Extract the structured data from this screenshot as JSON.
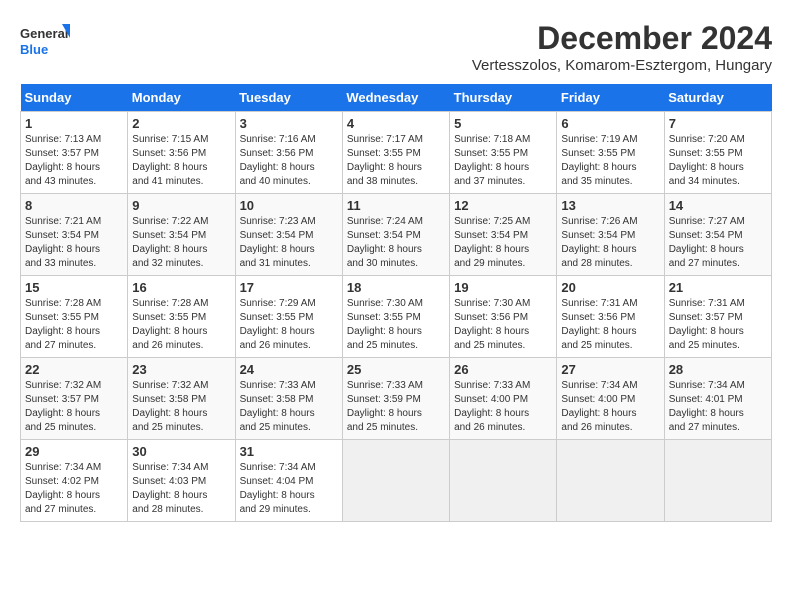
{
  "logo": {
    "line1": "General",
    "line2": "Blue"
  },
  "title": "December 2024",
  "location": "Vertesszolos, Komarom-Esztergom, Hungary",
  "weekdays": [
    "Sunday",
    "Monday",
    "Tuesday",
    "Wednesday",
    "Thursday",
    "Friday",
    "Saturday"
  ],
  "weeks": [
    [
      {
        "day": "1",
        "sunrise": "7:13 AM",
        "sunset": "3:57 PM",
        "daylight": "8 hours and 43 minutes."
      },
      {
        "day": "2",
        "sunrise": "7:15 AM",
        "sunset": "3:56 PM",
        "daylight": "8 hours and 41 minutes."
      },
      {
        "day": "3",
        "sunrise": "7:16 AM",
        "sunset": "3:56 PM",
        "daylight": "8 hours and 40 minutes."
      },
      {
        "day": "4",
        "sunrise": "7:17 AM",
        "sunset": "3:55 PM",
        "daylight": "8 hours and 38 minutes."
      },
      {
        "day": "5",
        "sunrise": "7:18 AM",
        "sunset": "3:55 PM",
        "daylight": "8 hours and 37 minutes."
      },
      {
        "day": "6",
        "sunrise": "7:19 AM",
        "sunset": "3:55 PM",
        "daylight": "8 hours and 35 minutes."
      },
      {
        "day": "7",
        "sunrise": "7:20 AM",
        "sunset": "3:55 PM",
        "daylight": "8 hours and 34 minutes."
      }
    ],
    [
      {
        "day": "8",
        "sunrise": "7:21 AM",
        "sunset": "3:54 PM",
        "daylight": "8 hours and 33 minutes."
      },
      {
        "day": "9",
        "sunrise": "7:22 AM",
        "sunset": "3:54 PM",
        "daylight": "8 hours and 32 minutes."
      },
      {
        "day": "10",
        "sunrise": "7:23 AM",
        "sunset": "3:54 PM",
        "daylight": "8 hours and 31 minutes."
      },
      {
        "day": "11",
        "sunrise": "7:24 AM",
        "sunset": "3:54 PM",
        "daylight": "8 hours and 30 minutes."
      },
      {
        "day": "12",
        "sunrise": "7:25 AM",
        "sunset": "3:54 PM",
        "daylight": "8 hours and 29 minutes."
      },
      {
        "day": "13",
        "sunrise": "7:26 AM",
        "sunset": "3:54 PM",
        "daylight": "8 hours and 28 minutes."
      },
      {
        "day": "14",
        "sunrise": "7:27 AM",
        "sunset": "3:54 PM",
        "daylight": "8 hours and 27 minutes."
      }
    ],
    [
      {
        "day": "15",
        "sunrise": "7:28 AM",
        "sunset": "3:55 PM",
        "daylight": "8 hours and 27 minutes."
      },
      {
        "day": "16",
        "sunrise": "7:28 AM",
        "sunset": "3:55 PM",
        "daylight": "8 hours and 26 minutes."
      },
      {
        "day": "17",
        "sunrise": "7:29 AM",
        "sunset": "3:55 PM",
        "daylight": "8 hours and 26 minutes."
      },
      {
        "day": "18",
        "sunrise": "7:30 AM",
        "sunset": "3:55 PM",
        "daylight": "8 hours and 25 minutes."
      },
      {
        "day": "19",
        "sunrise": "7:30 AM",
        "sunset": "3:56 PM",
        "daylight": "8 hours and 25 minutes."
      },
      {
        "day": "20",
        "sunrise": "7:31 AM",
        "sunset": "3:56 PM",
        "daylight": "8 hours and 25 minutes."
      },
      {
        "day": "21",
        "sunrise": "7:31 AM",
        "sunset": "3:57 PM",
        "daylight": "8 hours and 25 minutes."
      }
    ],
    [
      {
        "day": "22",
        "sunrise": "7:32 AM",
        "sunset": "3:57 PM",
        "daylight": "8 hours and 25 minutes."
      },
      {
        "day": "23",
        "sunrise": "7:32 AM",
        "sunset": "3:58 PM",
        "daylight": "8 hours and 25 minutes."
      },
      {
        "day": "24",
        "sunrise": "7:33 AM",
        "sunset": "3:58 PM",
        "daylight": "8 hours and 25 minutes."
      },
      {
        "day": "25",
        "sunrise": "7:33 AM",
        "sunset": "3:59 PM",
        "daylight": "8 hours and 25 minutes."
      },
      {
        "day": "26",
        "sunrise": "7:33 AM",
        "sunset": "4:00 PM",
        "daylight": "8 hours and 26 minutes."
      },
      {
        "day": "27",
        "sunrise": "7:34 AM",
        "sunset": "4:00 PM",
        "daylight": "8 hours and 26 minutes."
      },
      {
        "day": "28",
        "sunrise": "7:34 AM",
        "sunset": "4:01 PM",
        "daylight": "8 hours and 27 minutes."
      }
    ],
    [
      {
        "day": "29",
        "sunrise": "7:34 AM",
        "sunset": "4:02 PM",
        "daylight": "8 hours and 27 minutes."
      },
      {
        "day": "30",
        "sunrise": "7:34 AM",
        "sunset": "4:03 PM",
        "daylight": "8 hours and 28 minutes."
      },
      {
        "day": "31",
        "sunrise": "7:34 AM",
        "sunset": "4:04 PM",
        "daylight": "8 hours and 29 minutes."
      },
      null,
      null,
      null,
      null
    ]
  ]
}
